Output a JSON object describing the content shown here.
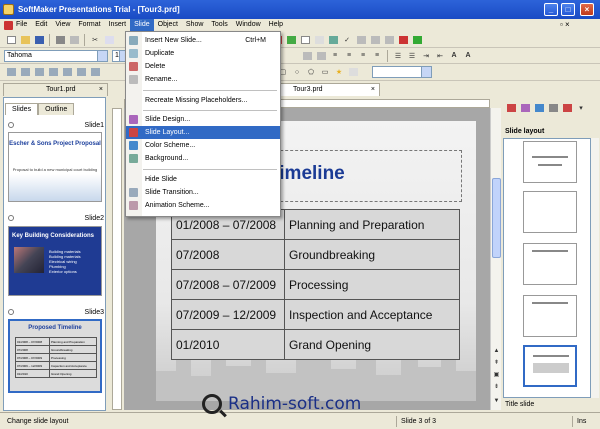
{
  "window": {
    "title": "SoftMaker Presentations Trial - [Tour3.prd]"
  },
  "menubar": {
    "items": [
      "File",
      "Edit",
      "View",
      "Format",
      "Insert",
      "Slide",
      "Object",
      "Show",
      "Tools",
      "Window",
      "Help"
    ],
    "active": "Slide"
  },
  "toolbar": {
    "font_name": "Tahoma",
    "font_size": "18"
  },
  "tabs": {
    "left_doc": "Tour1.prd",
    "main_doc": "Tour3.prd"
  },
  "left_panel": {
    "tabs": [
      "Slides",
      "Outline"
    ],
    "slides": [
      {
        "label": "Slide1",
        "title": "Escher & Sons Project Proposal",
        "subtitle": "Proposal to build a new municipal court building"
      },
      {
        "label": "Slide2",
        "title": "Key Building Considerations",
        "bullets": [
          "Building materials",
          "Building materials",
          "Electrical wiring",
          "Plumbing",
          "Exterior options"
        ]
      },
      {
        "label": "Slide3",
        "title": "Proposed Timeline"
      }
    ]
  },
  "slide_menu": {
    "items": [
      {
        "label": "Insert New Slide...",
        "shortcut": "Ctrl+M",
        "icon": "new-slide-icon"
      },
      {
        "label": "Duplicate",
        "icon": "duplicate-icon"
      },
      {
        "label": "Delete",
        "icon": "delete-icon"
      },
      {
        "label": "Rename...",
        "icon": "rename-icon"
      },
      {
        "label": "Recreate Missing Placeholders..."
      },
      {
        "label": "Slide Design...",
        "icon": "design-icon"
      },
      {
        "label": "Slide Layout...",
        "icon": "layout-icon",
        "highlighted": true
      },
      {
        "label": "Color Scheme...",
        "icon": "color-icon"
      },
      {
        "label": "Background...",
        "icon": "background-icon"
      },
      {
        "label": "Hide Slide"
      },
      {
        "label": "Slide Transition...",
        "icon": "transition-icon"
      },
      {
        "label": "Animation Scheme...",
        "icon": "animation-icon"
      }
    ]
  },
  "slide": {
    "title": "Proposed Timeline",
    "visible_title": "sed Timeline",
    "rows": [
      [
        "01/2008 – 07/2008",
        "Planning and Preparation"
      ],
      [
        "07/2008",
        "Groundbreaking"
      ],
      [
        "07/2008 – 07/2009",
        "Processing"
      ],
      [
        "07/2009 – 12/2009",
        "Inspection and Acceptance"
      ],
      [
        "01/2010",
        "Grand Opening"
      ]
    ]
  },
  "right_panel": {
    "heading": "Slide layout",
    "footer": "Title slide"
  },
  "status": {
    "hint": "Change slide layout",
    "slide_counter": "Slide 3 of 3",
    "mode": "Ins"
  },
  "watermark": {
    "text": "Rahim-soft.com"
  }
}
